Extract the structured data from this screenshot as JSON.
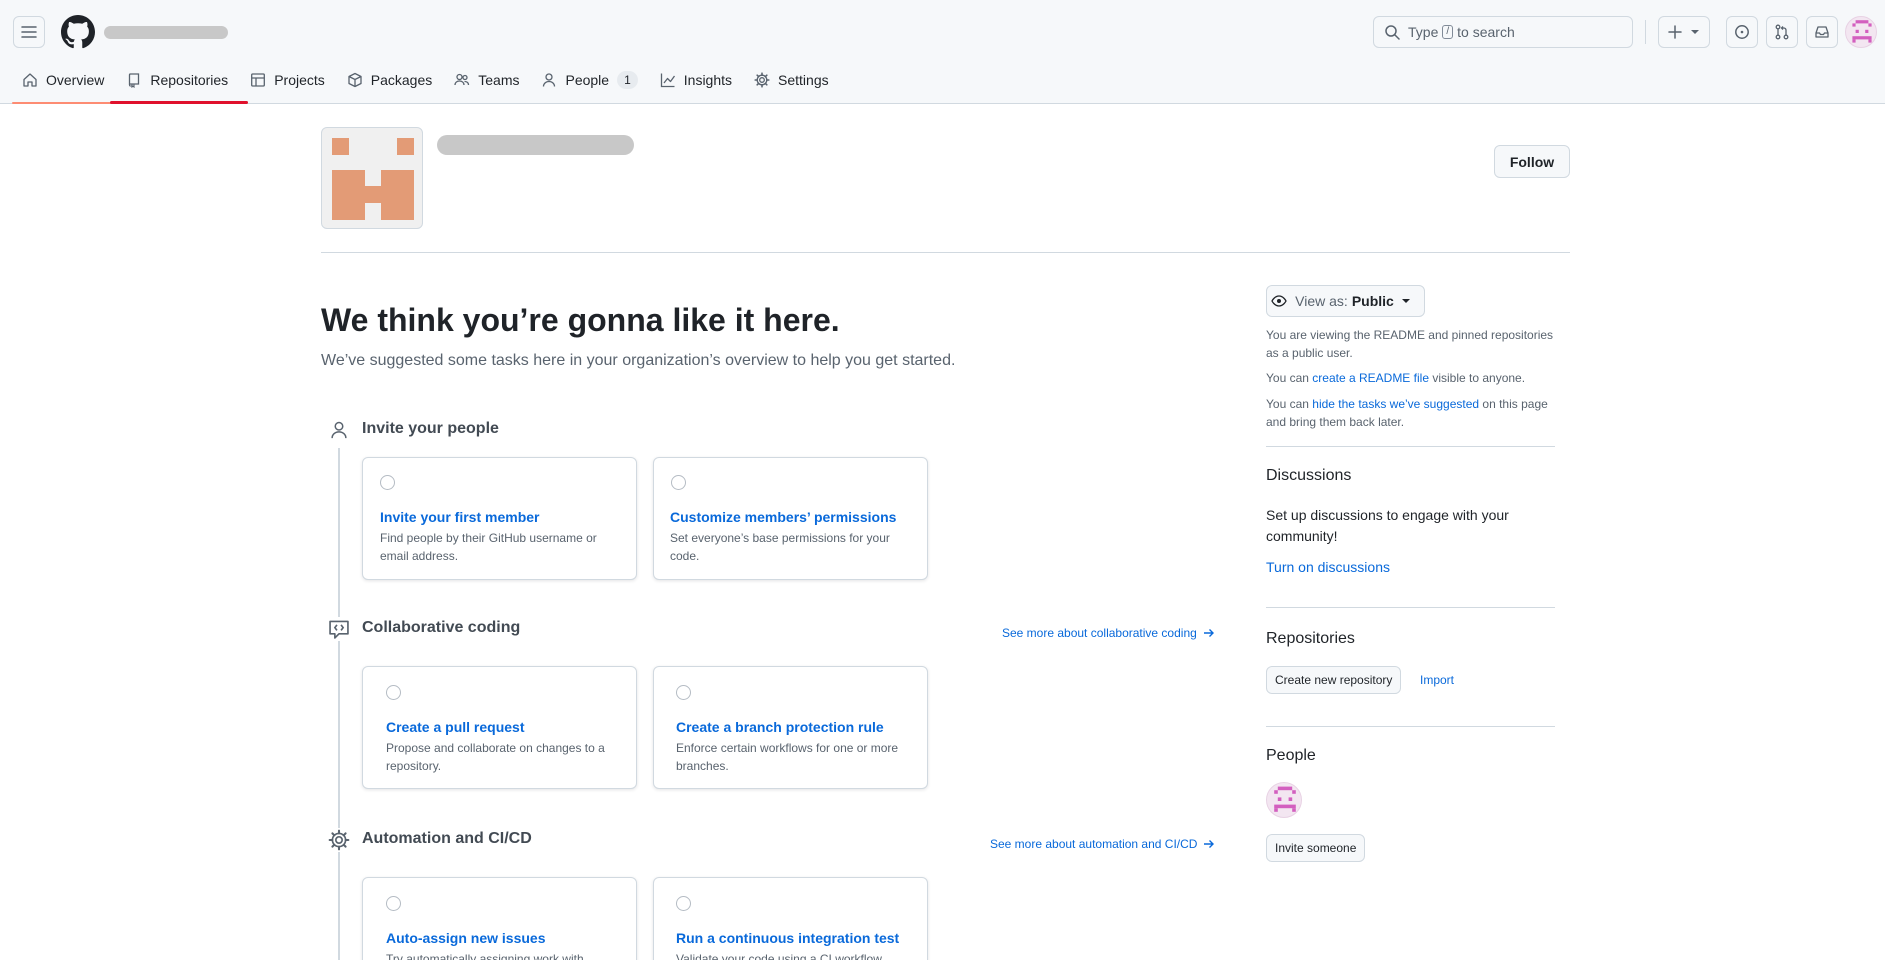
{
  "header": {
    "search_placeholder_before": "Type",
    "search_key": "/",
    "search_placeholder_after": "to search"
  },
  "tabs": [
    {
      "label": "Overview",
      "icon": "home-icon"
    },
    {
      "label": "Repositories",
      "icon": "repo-icon"
    },
    {
      "label": "Projects",
      "icon": "table-icon"
    },
    {
      "label": "Packages",
      "icon": "package-icon"
    },
    {
      "label": "Teams",
      "icon": "people-icon"
    },
    {
      "label": "People",
      "icon": "person-icon",
      "count": "1"
    },
    {
      "label": "Insights",
      "icon": "graph-icon"
    },
    {
      "label": "Settings",
      "icon": "gear-icon"
    }
  ],
  "org": {
    "follow_label": "Follow"
  },
  "main": {
    "title": "We think you’re gonna like it here.",
    "subtitle": "We’ve suggested some tasks here in your organization’s overview to help you get started.",
    "sections": [
      {
        "title": "Invite your people",
        "cards": [
          {
            "title": "Invite your first member",
            "desc": "Find people by their GitHub username or email address."
          },
          {
            "title": "Customize members’ permissions",
            "desc": "Set everyone’s base permissions for your code."
          }
        ]
      },
      {
        "title": "Collaborative coding",
        "see_more": "See more about collaborative coding",
        "cards": [
          {
            "title": "Create a pull request",
            "desc": "Propose and collaborate on changes to a repository."
          },
          {
            "title": "Create a branch protection rule",
            "desc": "Enforce certain workflows for one or more branches."
          }
        ]
      },
      {
        "title": "Automation and CI/CD",
        "see_more": "See more about automation and CI/CD",
        "cards": [
          {
            "title": "Auto-assign new issues",
            "desc": "Try automatically assigning work with"
          },
          {
            "title": "Run a continuous integration test",
            "desc": "Validate your code using a CI workflow"
          }
        ]
      }
    ]
  },
  "sidebar": {
    "view_as_label": "View as:",
    "view_as_value": "Public",
    "viewing_text": "You are viewing the README and pinned repositories as a public user.",
    "readme_prefix": "You can",
    "readme_link": "create a README file",
    "readme_suffix": "visible to anyone.",
    "hide_prefix": "You can",
    "hide_link": "hide the tasks we’ve suggested",
    "hide_suffix": "on this page and bring them back later.",
    "discussions_title": "Discussions",
    "discussions_text": "Set up discussions to engage with your community!",
    "discussions_link": "Turn on discussions",
    "repos_title": "Repositories",
    "create_repo_label": "Create new repository",
    "import_label": "Import",
    "people_title": "People",
    "invite_label": "Invite someone"
  },
  "colors": {
    "accent": "#0969da",
    "selected_underline": "#fd8c73",
    "annotation_underline": "#e0112c",
    "org_avatar": "#e39b76",
    "user_avatar": "#d35fbf"
  }
}
